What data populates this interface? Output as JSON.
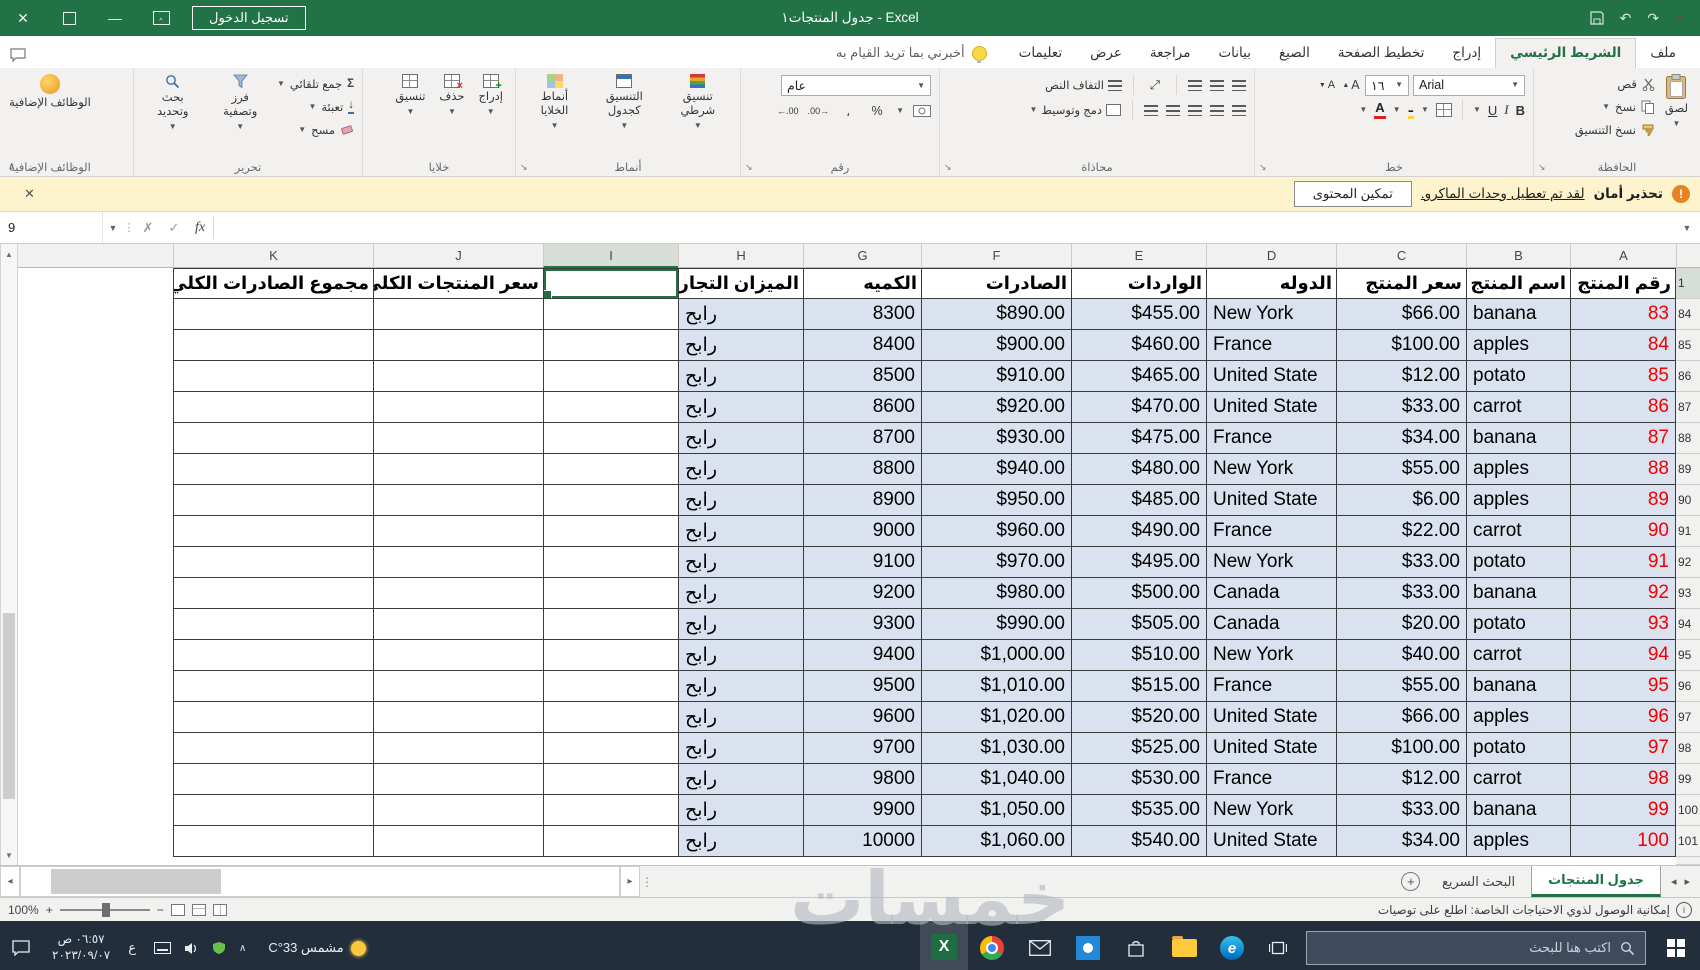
{
  "title_bar": {
    "title": "جدول المنتجات١ - Excel",
    "sign_in_label": "تسجيل الدخول"
  },
  "ribbon": {
    "tabs": [
      "ملف",
      "الشريط الرئيسي",
      "إدراج",
      "تخطيط الصفحة",
      "الصيغ",
      "بيانات",
      "مراجعة",
      "عرض",
      "تعليمات"
    ],
    "active_tab": "الشريط الرئيسي",
    "tell_me": "أخبرني بما تريد القيام به",
    "clipboard": {
      "label": "الحافظة",
      "paste": "لصق",
      "cut": "قص",
      "copy": "نسخ",
      "format_painter": "نسخ التنسيق"
    },
    "font": {
      "label": "خط",
      "name": "Arial",
      "size": "١٦",
      "bold": "B",
      "italic": "I",
      "underline": "U"
    },
    "alignment": {
      "label": "محاذاة",
      "wrap": "التفاف النص",
      "merge": "دمج وتوسيط"
    },
    "number": {
      "label": "رقم",
      "format": "عام",
      "percent": "%",
      "comma": "،",
      "inc_decimal": ".00→",
      "dec_decimal": "←.00"
    },
    "styles": {
      "label": "أنماط",
      "conditional": "تنسيق شرطي",
      "as_table": "التنسيق كجدول",
      "cell_styles": "أنماط الخلايا"
    },
    "cells": {
      "label": "خلايا",
      "insert": "إدراج",
      "delete": "حذف",
      "format": "تنسيق"
    },
    "editing": {
      "label": "تحرير",
      "sigma": "Σ",
      "autosum": "جمع تلقائي",
      "fill": "تعبئة",
      "clear": "مسح",
      "sort_filter": "فرز وتصفية",
      "find_select": "بحث وتحديد"
    },
    "addins": {
      "label": "الوظائف الإضافية",
      "button": "الوظائف الإضافية"
    }
  },
  "message_bar": {
    "title": "تحذير أمان",
    "message": "لقد تم تعطيل وحدات الماكرو.",
    "action": "تمكين المحتوى"
  },
  "formula_bar": {
    "name_box": "9",
    "fx": "fx"
  },
  "sheet": {
    "column_letters": [
      "A",
      "B",
      "C",
      "D",
      "E",
      "F",
      "G",
      "H",
      "I",
      "J",
      "K"
    ],
    "selected_column": "I",
    "header_row_number": "1",
    "first_data_row_number": 84,
    "headers": [
      "رقم المنتج",
      "اسم المنتج",
      "سعر المنتج",
      "الدوله",
      "الواردات",
      "الصادرات",
      "الكميه",
      "الميزان التجاري",
      "",
      "سعر المنتجات الكلي",
      "مجموع الصادرات الكلي"
    ],
    "rows": [
      [
        83,
        "banana",
        "$66.00",
        "New York",
        "$455.00",
        "$890.00",
        "8300",
        "رابح"
      ],
      [
        84,
        "apples",
        "$100.00",
        "France",
        "$460.00",
        "$900.00",
        "8400",
        "رابح"
      ],
      [
        85,
        "potato",
        "$12.00",
        "United State",
        "$465.00",
        "$910.00",
        "8500",
        "رابح"
      ],
      [
        86,
        "carrot",
        "$33.00",
        "United State",
        "$470.00",
        "$920.00",
        "8600",
        "رابح"
      ],
      [
        87,
        "banana",
        "$34.00",
        "France",
        "$475.00",
        "$930.00",
        "8700",
        "رابح"
      ],
      [
        88,
        "apples",
        "$55.00",
        "New York",
        "$480.00",
        "$940.00",
        "8800",
        "رابح"
      ],
      [
        89,
        "apples",
        "$6.00",
        "United State",
        "$485.00",
        "$950.00",
        "8900",
        "رابح"
      ],
      [
        90,
        "carrot",
        "$22.00",
        "France",
        "$490.00",
        "$960.00",
        "9000",
        "رابح"
      ],
      [
        91,
        "potato",
        "$33.00",
        "New York",
        "$495.00",
        "$970.00",
        "9100",
        "رابح"
      ],
      [
        92,
        "banana",
        "$33.00",
        "Canada",
        "$500.00",
        "$980.00",
        "9200",
        "رابح"
      ],
      [
        93,
        "potato",
        "$20.00",
        "Canada",
        "$505.00",
        "$990.00",
        "9300",
        "رابح"
      ],
      [
        94,
        "carrot",
        "$40.00",
        "New York",
        "$510.00",
        "$1,000.00",
        "9400",
        "رابح"
      ],
      [
        95,
        "banana",
        "$55.00",
        "France",
        "$515.00",
        "$1,010.00",
        "9500",
        "رابح"
      ],
      [
        96,
        "apples",
        "$66.00",
        "United State",
        "$520.00",
        "$1,020.00",
        "9600",
        "رابح"
      ],
      [
        97,
        "potato",
        "$100.00",
        "United State",
        "$525.00",
        "$1,030.00",
        "9700",
        "رابح"
      ],
      [
        98,
        "carrot",
        "$12.00",
        "France",
        "$530.00",
        "$1,040.00",
        "9800",
        "رابح"
      ],
      [
        99,
        "banana",
        "$33.00",
        "New York",
        "$535.00",
        "$1,050.00",
        "9900",
        "رابح"
      ],
      [
        100,
        "apples",
        "$34.00",
        "United State",
        "$540.00",
        "$1,060.00",
        "10000",
        "رابح"
      ]
    ]
  },
  "sheet_tabs": {
    "tabs": [
      "جدول المنتجات",
      "البحث السريع"
    ],
    "active": "جدول المنتجات"
  },
  "status_bar": {
    "zoom": "100%",
    "accessibility": "إمكانية الوصول لذوي الاحتياجات الخاصة: اطلع على توصيات"
  },
  "taskbar": {
    "search_placeholder": "اكتب هنا للبحث",
    "weather": "مشمس 33°C",
    "time": "٠٦:٥٧ ص",
    "date": "٢٠٢٣/٠٩/٠٧",
    "language": "ع"
  },
  "watermark": "خمسات",
  "colors": {
    "excel_green": "#217346",
    "table_fill": "#dbe2ef",
    "warning_bg": "#fdf3cd",
    "red_text": "#ff0000",
    "taskbar": "#222e3c"
  }
}
